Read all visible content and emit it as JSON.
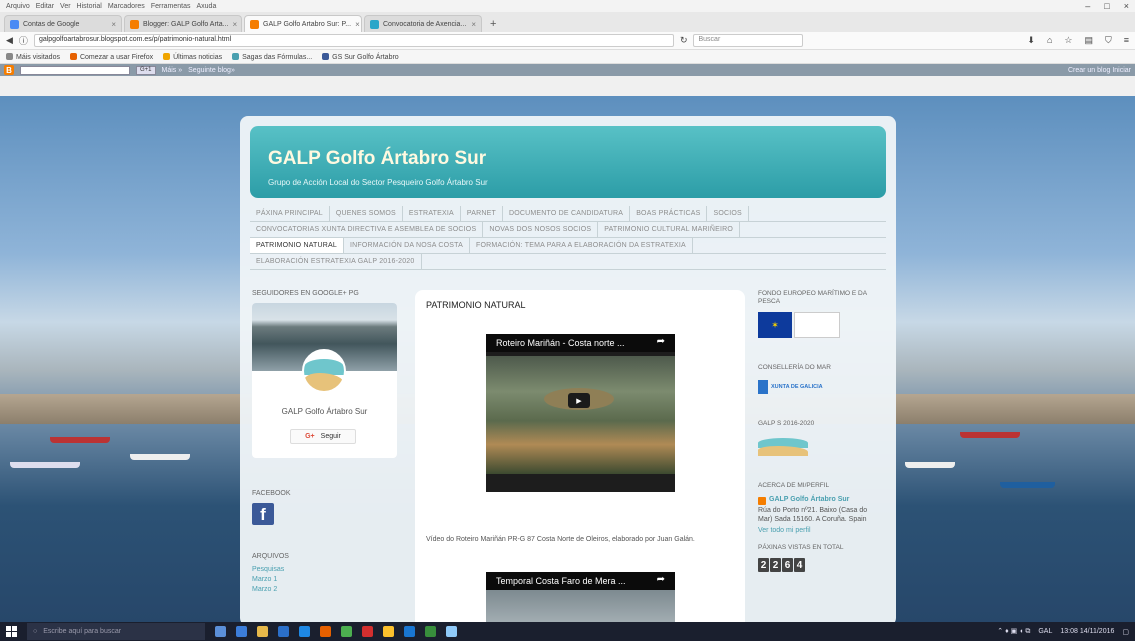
{
  "browser": {
    "menu_items": [
      "Arquivo",
      "Editar",
      "Ver",
      "Historial",
      "Marcadores",
      "Ferramentas",
      "Axuda"
    ],
    "window_controls": [
      "–",
      "□",
      "×"
    ],
    "tabs": [
      {
        "label": "Contas de Google",
        "active": false,
        "color": "#4a8af4"
      },
      {
        "label": "Blogger: GALP Golfo Arta...",
        "active": false,
        "color": "#f57d00"
      },
      {
        "label": "GALP Golfo Artabro Sur: P...",
        "active": true,
        "color": "#f57d00"
      },
      {
        "label": "Convocatoria de Axencia...",
        "active": false,
        "color": "#2aa6c9"
      }
    ],
    "new_tab": "+",
    "url": "galpgolfoartabrosur.blogspot.com.es/p/patrimonio-natural.html",
    "search_placeholder": "Buscar",
    "bookmarks": [
      "Máis visitados",
      "Comezar a usar Firefox",
      "Últimas noticias",
      "Sagas das Fórmulas...",
      "GS Sur Golfo Ártabro"
    ],
    "blogger_bar": {
      "search_button": "G+1",
      "more": "Máis »",
      "next_blog": "Seguinte blog»",
      "right_text": "Crear un blog   Iniciar"
    }
  },
  "blog": {
    "title": "GALP Golfo Ártabro Sur",
    "description": "Grupo de Acción Local do Sector Pesqueiro Golfo Ártabro Sur",
    "pages_rows": [
      [
        "PÁXINA PRINCIPAL",
        "QUENES SOMOS",
        "ESTRATEXIA",
        "PARNET",
        "DOCUMENTO DE CANDIDATURA",
        "BOAS PRÁCTICAS",
        "SOCIOS"
      ],
      [
        "CONVOCATORIAS XUNTA DIRECTIVA E ASEMBLEA DE SOCIOS",
        "NOVAS DOS NOSOS SOCIOS",
        "PATRIMONIO CULTURAL MARIÑEIRO"
      ],
      [
        "PATRIMONIO NATURAL",
        "INFORMACIÓN DA NOSA COSTA",
        "FORMACIÓN: TEMA PARA A ELABORACIÓN DA ESTRATEXIA"
      ],
      [
        "ELABORACIÓN ESTRATEXIA GALP 2016-2020"
      ]
    ],
    "active_page": "PATRIMONIO NATURAL"
  },
  "sidebar_left": {
    "gplus_title": "SEGUIDORES EN GOOGLE+ PG",
    "gplus_name": "GALP Golfo Ártabro Sur",
    "follow_label": "Seguir",
    "facebook_title": "FACEBOOK",
    "archive_title": "ARQUIVOS",
    "archive_links": [
      "Pesquisas",
      "Marzo 1",
      "Marzo 2"
    ]
  },
  "post": {
    "title": "PATRIMONIO NATURAL",
    "video1_title": "Roteiro Mariñán - Costa norte ...",
    "video2_title": "Temporal Costa Faro de Mera ...",
    "body": "Vídeo do Roteiro Mariñán PR-G 87 Costa Norte de Oleiros, elaborado por Juan Galán."
  },
  "sidebar_right": {
    "feamp_title": "FONDO EUROPEO MARÍTIMO E DA PESCA",
    "conselleria_title": "CONSELLERÍA DO MAR",
    "xunta_text": "XUNTA DE GALICIA",
    "galp_title": "GALP S 2016-2020",
    "about_title": "ACERCA DE MI/PERFIL",
    "about_name": "GALP Golfo Ártabro Sur",
    "about_text": "Rúa do Porto nº21. Baixo (Casa do Mar) Sada 15160. A Coruña. Spain",
    "about_link": "Ver todo mi perfil",
    "visits_title": "PÁXINAS VISTAS EN TOTAL",
    "visits": [
      "2",
      "2",
      "6",
      "4"
    ]
  },
  "taskbar": {
    "search_placeholder": "Escribe aquí para buscar",
    "time": "13:08",
    "date": "14/11/2016",
    "language": "GAL"
  }
}
